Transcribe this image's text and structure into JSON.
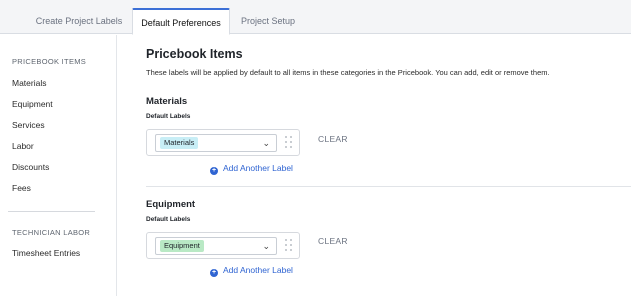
{
  "tabs": [
    {
      "label": "Create Project Labels"
    },
    {
      "label": "Default Preferences"
    },
    {
      "label": "Project Setup"
    }
  ],
  "sidebar": {
    "pricebook_heading": "PRICEBOOK ITEMS",
    "pricebook_items": [
      "Materials",
      "Equipment",
      "Services",
      "Labor",
      "Discounts",
      "Fees"
    ],
    "tech_heading": "TECHNICIAN LABOR",
    "tech_items": [
      "Timesheet Entries"
    ]
  },
  "main": {
    "title": "Pricebook Items",
    "description": "These labels will be applied by default to all items in these categories in the Pricebook. You can add, edit or remove them.",
    "sections": [
      {
        "title": "Materials",
        "sub": "Default Labels",
        "tag": "Materials",
        "clear": "CLEAR",
        "add": "Add Another Label"
      },
      {
        "title": "Equipment",
        "sub": "Default Labels",
        "tag": "Equipment",
        "clear": "CLEAR",
        "add": "Add Another Label"
      }
    ]
  },
  "icons": {
    "chevron": "chevron-down-icon",
    "grip": "drag-handle-icon",
    "add": "plus-circle-icon"
  },
  "colors": {
    "accent": "#2f64d2",
    "tag_materials": "#c8eef6",
    "tag_equipment": "#b9e9c5"
  }
}
